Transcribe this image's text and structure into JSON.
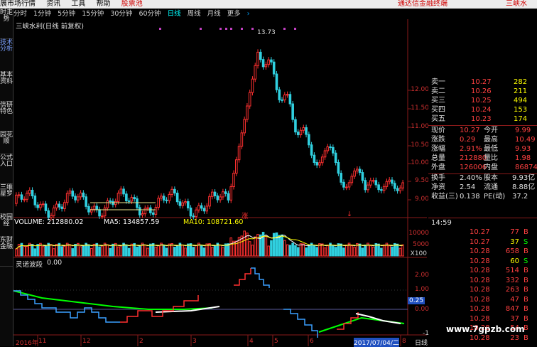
{
  "menubar": {
    "items": [
      "展市场行情",
      "资讯",
      "工具",
      "帮助"
    ],
    "highlight": "股票池",
    "right_text_1": "通达信金融终端",
    "right_text_2": "三峡水"
  },
  "left_tabs": [
    "时走势",
    "技术分析",
    "基本资料",
    "信研特色",
    "园花顺",
    "公式入口",
    "三维星罗",
    "校园经",
    "东财金融"
  ],
  "toolbar": {
    "periods": [
      "分时",
      "1分钟",
      "5分钟",
      "15分钟",
      "30分钟",
      "60分钟",
      "日线",
      "周线",
      "月线",
      "更多"
    ],
    "selected": "日线",
    "more_arrow": "›"
  },
  "main_chart": {
    "title": "三峡水利(日线 前复权)",
    "peak_label": "13.73",
    "axis_ticks": [
      "12.00",
      "11.50",
      "11.00",
      "10.50",
      "10.00",
      "9.50",
      "9.00"
    ],
    "markers": [
      "涨",
      "↓"
    ]
  },
  "volume_panel": {
    "label_volume": "VOLUME: 212880.02",
    "label_ma5": "MA5: 134857.59",
    "label_ma10": "MA10: 108721.60",
    "axis_ticks": [
      "10000",
      "5000",
      "X100"
    ],
    "colors": {
      "volume": "#ffffff",
      "ma5": "#ffffff",
      "ma10": "#ffff00"
    }
  },
  "indicator_panel": {
    "title": "灵诺波段",
    "value": "0.00",
    "axis_ticks": [
      "2.00",
      "1.00",
      "0.25",
      "0.00",
      "-1"
    ],
    "badge": "0.25"
  },
  "date_axis": {
    "labels": [
      "2016年",
      "11",
      "12",
      "2",
      "3",
      "4",
      "5",
      "6",
      "2017/07/04/二",
      "8"
    ],
    "right_label": "日线"
  },
  "quote_panel": {
    "asks": [
      {
        "label": "卖一",
        "price": "10.27",
        "vol": "282"
      },
      {
        "label": "卖二",
        "price": "10.26",
        "vol": "211"
      },
      {
        "label": "买三",
        "price": "10.25",
        "vol": "494"
      },
      {
        "label": "买四",
        "price": "10.24",
        "vol": "153"
      },
      {
        "label": "买五",
        "price": "10.23",
        "vol": "174"
      }
    ],
    "stats": [
      {
        "l1": "现价",
        "v1": "10.27",
        "l2": "今开",
        "v2": "9.99"
      },
      {
        "l1": "涨跌",
        "v1": "0.29",
        "l2": "最高",
        "v2": "10.49"
      },
      {
        "l1": "涨幅",
        "v1": "2.91%",
        "l2": "最低",
        "v2": "9.93"
      },
      {
        "l1": "总量",
        "v1": "212880",
        "l2": "量比",
        "v2": "1.98"
      },
      {
        "l1": "外盘",
        "v1": "126006",
        "l2": "内盘",
        "v2": "86874"
      }
    ],
    "stats2": [
      {
        "l1": "换手",
        "v1": "2.40%",
        "l2": "股本",
        "v2": "9.93亿"
      },
      {
        "l1": "净资",
        "v1": "2.54",
        "l2": "流通",
        "v2": "8.88亿"
      },
      {
        "l1": "收益(三)",
        "v1": "0.138",
        "l2": "PE(动)",
        "v2": "37.2"
      }
    ]
  },
  "ticks": {
    "time": "14:59",
    "rows": [
      {
        "price": "10.27",
        "vol": "77",
        "side": "B"
      },
      {
        "price": "10.27",
        "vol": "37",
        "side": "S"
      },
      {
        "price": "10.28",
        "vol": "658",
        "side": "B"
      },
      {
        "price": "10.28",
        "vol": "60",
        "side": "S"
      },
      {
        "price": "10.28",
        "vol": "514",
        "side": "B"
      },
      {
        "price": "10.28",
        "vol": "332",
        "side": "B"
      },
      {
        "price": "10.28",
        "vol": "263",
        "side": "B"
      },
      {
        "price": "10.28",
        "vol": "47",
        "side": "B"
      },
      {
        "price": "10.28",
        "vol": "847",
        "side": "B"
      },
      {
        "price": "10.28",
        "vol": "37",
        "side": "B"
      },
      {
        "price": "10.28",
        "vol": "54",
        "side": "B"
      },
      {
        "price": "10.28",
        "vol": "23",
        "side": "B"
      }
    ]
  },
  "watermark": "www.7gpzb.com"
}
